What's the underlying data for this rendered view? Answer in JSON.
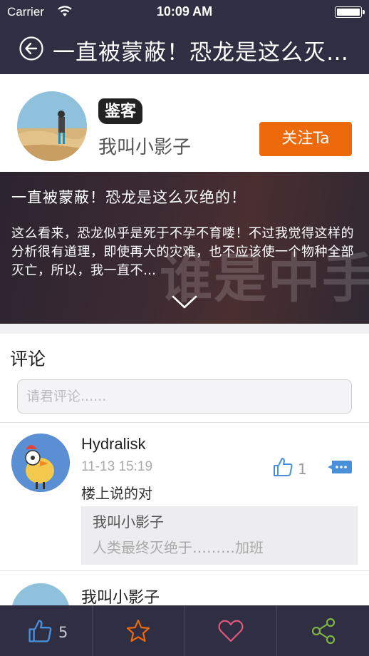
{
  "status": {
    "carrier": "Carrier",
    "time": "10:09 AM"
  },
  "nav": {
    "title": "一直被蒙蔽！恐龙是这么灭绝的！"
  },
  "author": {
    "badge": "鉴客",
    "name": "我叫小影子",
    "follow_label": "关注Ta"
  },
  "article": {
    "title": "一直被蒙蔽！恐龙是这么灭绝的！",
    "excerpt": "这么看来，恐龙似乎是死于不孕不育喽！不过我觉得这样的分析很有道理，即使再大的灾难，也不应该使一个物种全部灭亡，所以，我一直不…",
    "background_text": "谁是中手"
  },
  "comments": {
    "section_label": "评论",
    "input_placeholder": "请君评论......",
    "items": [
      {
        "user": "Hydralisk",
        "time": "11-13 15:19",
        "likes": "1",
        "text": "楼上说的对",
        "quote": {
          "user": "我叫小影子",
          "text": "人类最终灭绝于………加班"
        }
      },
      {
        "user": "我叫小影子"
      }
    ]
  },
  "tabbar": {
    "like_count": "5"
  },
  "colors": {
    "nav_bg": "#2f2e43",
    "accent_orange": "#ed6a0c",
    "blue": "#4a90d9",
    "green": "#7cb342",
    "pink": "#e05a7a"
  }
}
